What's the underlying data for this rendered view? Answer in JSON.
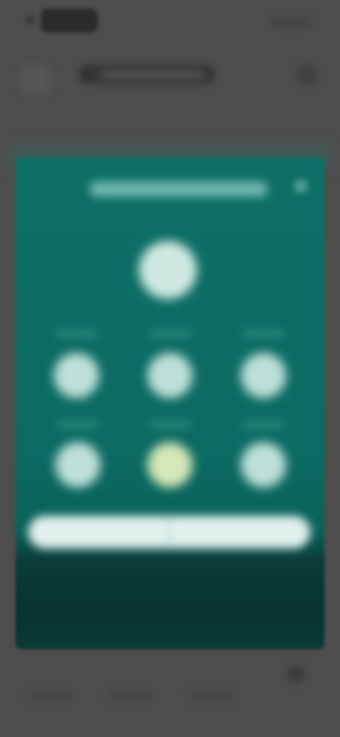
{
  "status_bar": {
    "time": "",
    "icons": [
      "signal-icon",
      "wifi-icon",
      "battery-icon"
    ]
  },
  "header": {
    "title": "",
    "back_icon": "back-icon",
    "action_icon": "more-icon"
  },
  "panel": {
    "title": "",
    "close_icon": "close-icon",
    "options": [
      {
        "label": ""
      },
      {
        "label": ""
      },
      {
        "label": ""
      },
      {
        "label": ""
      },
      {
        "label": ""
      },
      {
        "label": ""
      }
    ],
    "pill": {
      "left_label": "",
      "right_label": ""
    }
  },
  "bottom_nav": {
    "items": [
      {
        "label": ""
      },
      {
        "label": ""
      },
      {
        "label": ""
      }
    ]
  },
  "colors": {
    "panel_teal": "#0d6f66",
    "panel_dark": "#073330",
    "circle": "#bfe0d9",
    "accent_circle": "#d4e8b8",
    "pill": "#e3f1ee",
    "background": "#4d4d4d"
  }
}
